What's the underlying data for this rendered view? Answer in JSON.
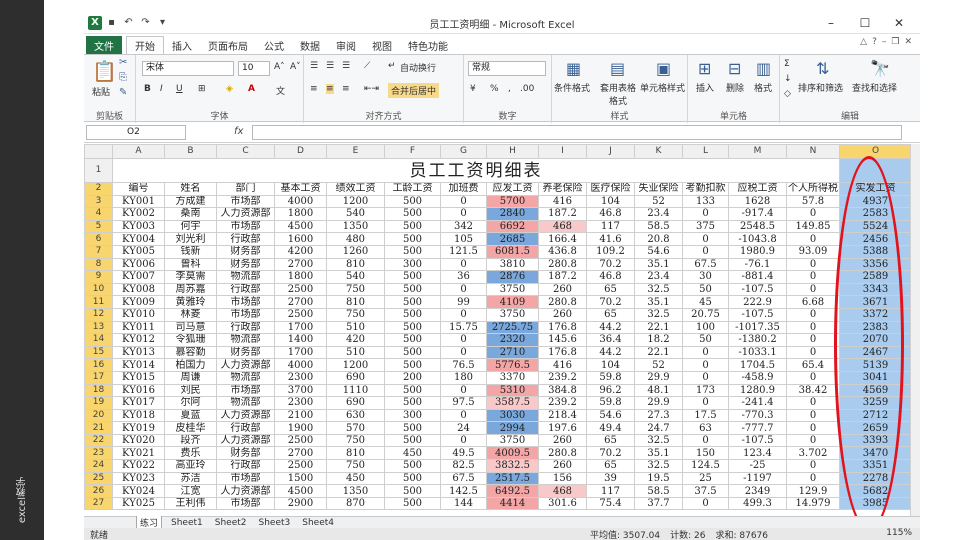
{
  "side_text": "excel教学",
  "window": {
    "title": "员工工资明细 - Microsoft Excel",
    "logo": "X",
    "min": "–",
    "max": "☐",
    "close": "✕"
  },
  "tabs": [
    "文件",
    "开始",
    "插入",
    "页面布局",
    "公式",
    "数据",
    "审阅",
    "视图",
    "特色功能"
  ],
  "ribbon": {
    "clipboard": {
      "label": "剪贴板",
      "paste": "粘贴"
    },
    "font": {
      "label": "字体",
      "name": "宋体",
      "size": "10",
      "bold": "B",
      "italic": "I",
      "underline": "U"
    },
    "align": {
      "label": "对齐方式",
      "wrap": "自动换行",
      "merge": "合并后居中"
    },
    "number": {
      "label": "数字",
      "format": "常规"
    },
    "styles": {
      "label": "样式",
      "cond": "条件格式",
      "table": "套用表格格式",
      "cell": "单元格样式"
    },
    "cells": {
      "label": "单元格",
      "insert": "插入",
      "delete": "删除",
      "format": "格式"
    },
    "edit": {
      "label": "编辑",
      "sort": "排序和筛选",
      "find": "查找和选择"
    }
  },
  "formula": {
    "namebox": "O2",
    "fx": "fx"
  },
  "grid": {
    "cols": [
      "",
      "A",
      "B",
      "C",
      "D",
      "E",
      "F",
      "G",
      "H",
      "I",
      "J",
      "K",
      "L",
      "M",
      "N",
      "O"
    ],
    "title": "员工工资明细表",
    "headers": [
      "编号",
      "姓名",
      "部门",
      "基本工资",
      "绩效工资",
      "工龄工资",
      "加班费",
      "应发工资",
      "养老保险",
      "医疗保险",
      "失业保险",
      "考勤扣款",
      "应税工资",
      "个人所得税",
      "实发工资"
    ],
    "rows": [
      [
        "KY001",
        "方成建",
        "市场部",
        "4000",
        "1200",
        "500",
        "0",
        "5700",
        "416",
        "104",
        "52",
        "133",
        "1628",
        "57.8",
        "4937"
      ],
      [
        "KY002",
        "桑南",
        "人力资源部",
        "1800",
        "540",
        "500",
        "0",
        "2840",
        "187.2",
        "46.8",
        "23.4",
        "0",
        "-917.4",
        "0",
        "2583"
      ],
      [
        "KY003",
        "何宇",
        "市场部",
        "4500",
        "1350",
        "500",
        "342",
        "6692",
        "468",
        "117",
        "58.5",
        "375",
        "2548.5",
        "149.85",
        "5524"
      ],
      [
        "KY004",
        "刘光利",
        "行政部",
        "1600",
        "480",
        "500",
        "105",
        "2685",
        "166.4",
        "41.6",
        "20.8",
        "0",
        "-1043.8",
        "0",
        "2456"
      ],
      [
        "KY005",
        "钱新",
        "财务部",
        "4200",
        "1260",
        "500",
        "121.5",
        "6081.5",
        "436.8",
        "109.2",
        "54.6",
        "0",
        "1980.9",
        "93.09",
        "5388"
      ],
      [
        "KY006",
        "曾科",
        "财务部",
        "2700",
        "810",
        "300",
        "0",
        "3810",
        "280.8",
        "70.2",
        "35.1",
        "67.5",
        "-76.1",
        "0",
        "3356"
      ],
      [
        "KY007",
        "李莫需",
        "物流部",
        "1800",
        "540",
        "500",
        "36",
        "2876",
        "187.2",
        "46.8",
        "23.4",
        "30",
        "-881.4",
        "0",
        "2589"
      ],
      [
        "KY008",
        "周苏嘉",
        "行政部",
        "2500",
        "750",
        "500",
        "0",
        "3750",
        "260",
        "65",
        "32.5",
        "50",
        "-107.5",
        "0",
        "3343"
      ],
      [
        "KY009",
        "黄雅玲",
        "市场部",
        "2700",
        "810",
        "500",
        "99",
        "4109",
        "280.8",
        "70.2",
        "35.1",
        "45",
        "222.9",
        "6.68",
        "3671"
      ],
      [
        "KY010",
        "林菱",
        "市场部",
        "2500",
        "750",
        "500",
        "0",
        "3750",
        "260",
        "65",
        "32.5",
        "20.75",
        "-107.5",
        "0",
        "3372"
      ],
      [
        "KY011",
        "司马意",
        "行政部",
        "1700",
        "510",
        "500",
        "15.75",
        "2725.75",
        "176.8",
        "44.2",
        "22.1",
        "100",
        "-1017.35",
        "0",
        "2383"
      ],
      [
        "KY012",
        "令狐珊",
        "物流部",
        "1400",
        "420",
        "500",
        "0",
        "2320",
        "145.6",
        "36.4",
        "18.2",
        "50",
        "-1380.2",
        "0",
        "2070"
      ],
      [
        "KY013",
        "慕容勤",
        "财务部",
        "1700",
        "510",
        "500",
        "0",
        "2710",
        "176.8",
        "44.2",
        "22.1",
        "0",
        "-1033.1",
        "0",
        "2467"
      ],
      [
        "KY014",
        "柏国力",
        "人力资源部",
        "4000",
        "1200",
        "500",
        "76.5",
        "5776.5",
        "416",
        "104",
        "52",
        "0",
        "1704.5",
        "65.4",
        "5139"
      ],
      [
        "KY015",
        "周谦",
        "物流部",
        "2300",
        "690",
        "200",
        "180",
        "3370",
        "239.2",
        "59.8",
        "29.9",
        "0",
        "-458.9",
        "0",
        "3041"
      ],
      [
        "KY016",
        "刘民",
        "市场部",
        "3700",
        "1110",
        "500",
        "0",
        "5310",
        "384.8",
        "96.2",
        "48.1",
        "173",
        "1280.9",
        "38.42",
        "4569"
      ],
      [
        "KY017",
        "尔阿",
        "物流部",
        "2300",
        "690",
        "500",
        "97.5",
        "3587.5",
        "239.2",
        "59.8",
        "29.9",
        "0",
        "-241.4",
        "0",
        "3259"
      ],
      [
        "KY018",
        "夏蓝",
        "人力资源部",
        "2100",
        "630",
        "300",
        "0",
        "3030",
        "218.4",
        "54.6",
        "27.3",
        "17.5",
        "-770.3",
        "0",
        "2712"
      ],
      [
        "KY019",
        "皮桂华",
        "行政部",
        "1900",
        "570",
        "500",
        "24",
        "2994",
        "197.6",
        "49.4",
        "24.7",
        "63",
        "-777.7",
        "0",
        "2659"
      ],
      [
        "KY020",
        "段齐",
        "人力资源部",
        "2500",
        "750",
        "500",
        "0",
        "3750",
        "260",
        "65",
        "32.5",
        "0",
        "-107.5",
        "0",
        "3393"
      ],
      [
        "KY021",
        "费乐",
        "财务部",
        "2700",
        "810",
        "450",
        "49.5",
        "4009.5",
        "280.8",
        "70.2",
        "35.1",
        "150",
        "123.4",
        "3.702",
        "3470"
      ],
      [
        "KY022",
        "高亚玲",
        "行政部",
        "2500",
        "750",
        "500",
        "82.5",
        "3832.5",
        "260",
        "65",
        "32.5",
        "124.5",
        "-25",
        "0",
        "3351"
      ],
      [
        "KY023",
        "苏洁",
        "市场部",
        "1500",
        "450",
        "500",
        "67.5",
        "2517.5",
        "156",
        "39",
        "19.5",
        "25",
        "-1197",
        "0",
        "2278"
      ],
      [
        "KY024",
        "江宽",
        "人力资源部",
        "4500",
        "1350",
        "500",
        "142.5",
        "6492.5",
        "468",
        "117",
        "58.5",
        "37.5",
        "2349",
        "129.9",
        "5682"
      ],
      [
        "KY025",
        "王利伟",
        "市场部",
        "2900",
        "870",
        "500",
        "144",
        "4414",
        "301.6",
        "75.4",
        "37.7",
        "0",
        "499.3",
        "14.979",
        "3985"
      ]
    ]
  },
  "sheets": [
    "练习",
    "Sheet1",
    "Sheet2",
    "Sheet3",
    "Sheet4"
  ],
  "status": {
    "ready": "就绪",
    "avg": "平均值: 3507.04",
    "count": "计数: 26",
    "sum": "求和: 87676",
    "zoom": "115%"
  }
}
